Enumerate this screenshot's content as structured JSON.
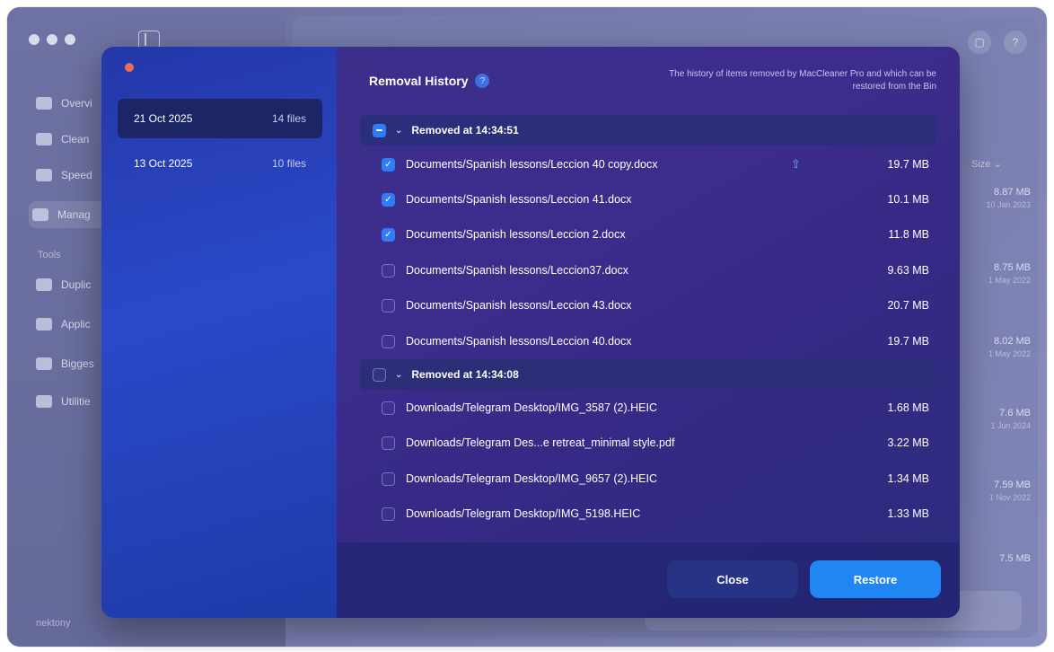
{
  "background_app": {
    "sidebar": {
      "items": [
        {
          "label": "Overvi",
          "icon": "overview-icon"
        },
        {
          "label": "Clean",
          "icon": "broom-icon"
        },
        {
          "label": "Speed",
          "icon": "speed-icon"
        },
        {
          "label": "Manag",
          "icon": "manage-icon"
        }
      ],
      "tools_heading": "Tools",
      "tools": [
        {
          "label": "Duplic",
          "icon": "duplicates-icon"
        },
        {
          "label": "Applic",
          "icon": "applications-icon"
        },
        {
          "label": "Bigges",
          "icon": "biggest-files-icon"
        },
        {
          "label": "Utilitie",
          "icon": "utilities-icon"
        }
      ],
      "brand": "nektony"
    },
    "size_header": "Size",
    "size_column": [
      {
        "value": "8.87 MB",
        "sub": "10 Jan 2023"
      },
      {
        "value": "8.75 MB",
        "sub": "1 May 2022"
      },
      {
        "value": "8.02 MB",
        "sub": "1 May 2022"
      },
      {
        "value": "7.6 MB",
        "sub": "1 Jun 2024"
      },
      {
        "value": "7.59 MB",
        "sub": "1 Nov 2022"
      },
      {
        "value": "7.5 MB",
        "sub": ""
      }
    ],
    "top_buttons": {
      "chat": "▢",
      "help": "?"
    }
  },
  "modal": {
    "title": "Removal History",
    "help": "?",
    "description": "The history of items removed by MacCleaner Pro and which can be restored from the Bin",
    "dates": [
      {
        "date": "21 Oct 2025",
        "count": "14 files",
        "active": true
      },
      {
        "date": "13 Oct 2025",
        "count": "10 files",
        "active": false
      }
    ],
    "groups": [
      {
        "title": "Removed at 14:34:51",
        "state": "mixed",
        "files": [
          {
            "name": "Documents/Spanish lessons/Leccion 40 copy.docx",
            "size": "19.7 MB",
            "checked": true
          },
          {
            "name": "Documents/Spanish lessons/Leccion 41.docx",
            "size": "10.1 MB",
            "checked": true
          },
          {
            "name": "Documents/Spanish lessons/Leccion 2.docx",
            "size": "11.8 MB",
            "checked": true
          },
          {
            "name": "Documents/Spanish lessons/Leccion37.docx",
            "size": "9.63 MB",
            "checked": false
          },
          {
            "name": "Documents/Spanish lessons/Leccion 43.docx",
            "size": "20.7 MB",
            "checked": false
          },
          {
            "name": "Documents/Spanish lessons/Leccion 40.docx",
            "size": "19.7 MB",
            "checked": false
          }
        ]
      },
      {
        "title": "Removed at 14:34:08",
        "state": "empty",
        "files": [
          {
            "name": "Downloads/Telegram Desktop/IMG_3587 (2).HEIC",
            "size": "1.68 MB",
            "checked": false
          },
          {
            "name": "Downloads/Telegram Des...e retreat_minimal style.pdf",
            "size": "3.22 MB",
            "checked": false
          },
          {
            "name": "Downloads/Telegram Desktop/IMG_9657 (2).HEIC",
            "size": "1.34 MB",
            "checked": false
          },
          {
            "name": "Downloads/Telegram Desktop/IMG_5198.HEIC",
            "size": "1.33 MB",
            "checked": false
          }
        ]
      }
    ],
    "buttons": {
      "close": "Close",
      "restore": "Restore"
    }
  }
}
